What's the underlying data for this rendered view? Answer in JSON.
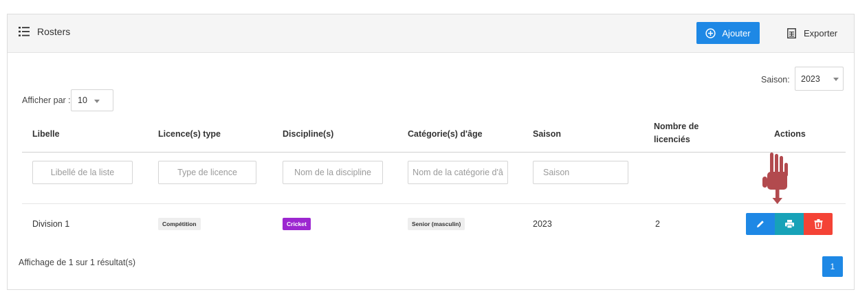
{
  "header": {
    "title": "Rosters",
    "add_label": "Ajouter",
    "export_label": "Exporter"
  },
  "season_filter": {
    "label": "Saison:",
    "value": "2023"
  },
  "per_page": {
    "label": "Afficher par :",
    "value": "10"
  },
  "table": {
    "columns": [
      "Libelle",
      "Licence(s) type",
      "Discipline(s)",
      "Catégorie(s) d'âge",
      "Saison",
      "Nombre de",
      "licenciés",
      "Actions"
    ],
    "filters": [
      "Libellé de la liste",
      "Type de licence",
      "Nom de la discipline",
      "Nom de la catégorie d'â",
      "Saison"
    ],
    "rows": [
      {
        "libelle": "Division 1",
        "licence_type": "Compétition",
        "discipline": "Cricket",
        "categorie": "Senior (masculin)",
        "saison": "2023",
        "nombre": "2"
      }
    ]
  },
  "footer": {
    "summary": "Affichage de 1 sur 1 résultat(s)",
    "page": "1"
  },
  "colors": {
    "primary": "#1e88e5",
    "info": "#17a2b8",
    "danger": "#f44336",
    "purple": "#9c27d0",
    "pointer": "#b24a4e"
  }
}
